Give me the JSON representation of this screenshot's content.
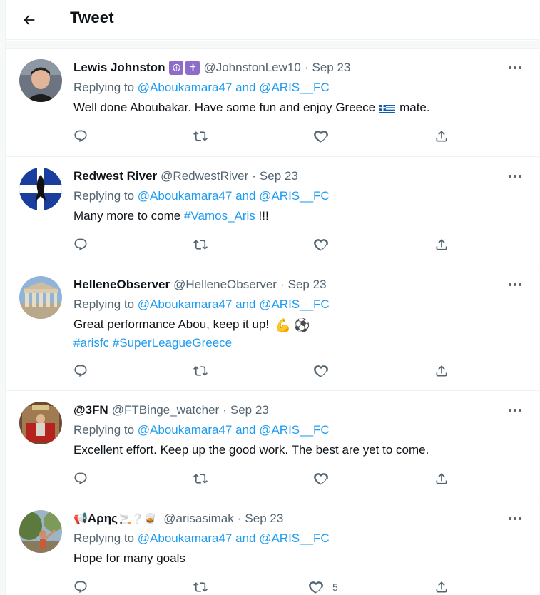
{
  "header": {
    "title": "Tweet"
  },
  "tweets": [
    {
      "name": "Lewis Johnston",
      "badges": [
        "☮",
        "✝"
      ],
      "handle": "@JohnstonLew10",
      "date": "Sep 23",
      "replying_prefix": "Replying to",
      "mention1": "@Aboukamara47",
      "and": "and",
      "mention2": "@ARIS__FC",
      "text_before": "Well done Aboubakar. Have some fun and enjoy Greece",
      "text_after": "mate.",
      "likes": ""
    },
    {
      "name": "Redwest River",
      "handle": "@RedwestRiver",
      "date": "Sep 23",
      "replying_prefix": "Replying to",
      "mention1": "@Aboukamara47",
      "and": "and",
      "mention2": "@ARIS__FC",
      "text_before": "Many more to come",
      "hashtag": "#Vamos_Aris",
      "text_after": "!!!",
      "likes": ""
    },
    {
      "name": "HelleneObserver",
      "handle": "@HelleneObserver",
      "date": "Sep 23",
      "replying_prefix": "Replying to",
      "mention1": "@Aboukamara47",
      "and": "and",
      "mention2": "@ARIS__FC",
      "text_before": "Great performance Abou, keep it up!",
      "emojis": [
        "💪",
        "⚽"
      ],
      "hashtag1": "#arisfc",
      "hashtag2": "#SuperLeagueGreece",
      "likes": ""
    },
    {
      "name": "@3FN",
      "handle": "@FTBinge_watcher",
      "date": "Sep 23",
      "replying_prefix": "Replying to",
      "mention1": "@Aboukamara47",
      "and": "and",
      "mention2": "@ARIS__FC",
      "text_before": "Excellent effort. Keep up the good work. The best are yet to come.",
      "likes": ""
    },
    {
      "name_emoji_before": "📢",
      "name": "Αρης",
      "name_emoji_after": "🚬❔🥃",
      "handle": "@arisasimak",
      "date": "Sep 23",
      "replying_prefix": "Replying to",
      "mention1": "@Aboukamara47",
      "and": "and",
      "mention2": "@ARIS__FC",
      "text_before": "Hope for many goals",
      "likes": "5"
    }
  ],
  "separator": "·",
  "colors": {
    "link": "#1d9bf0",
    "muted": "#536471",
    "text": "#0f1419",
    "divider": "#eff3f4"
  },
  "icons": {
    "back": "arrow-left-icon",
    "reply": "reply-icon",
    "retweet": "retweet-icon",
    "like": "heart-icon",
    "share": "share-icon",
    "more": "more-dots-icon"
  }
}
